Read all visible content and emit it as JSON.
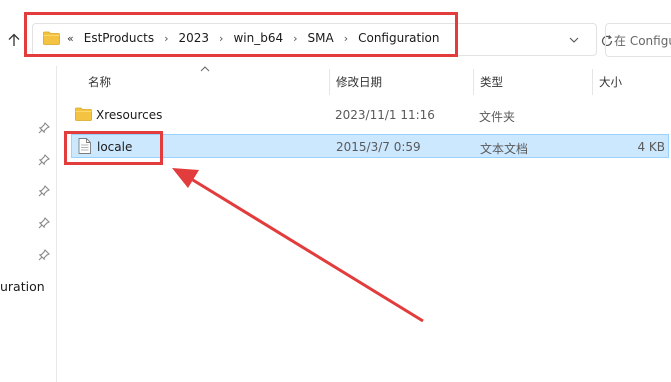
{
  "address": {
    "overflow_marker": "«",
    "path": [
      "EstProducts",
      "2023",
      "win_b64",
      "SMA",
      "Configuration"
    ]
  },
  "search": {
    "placeholder": "在 Configu"
  },
  "nav": {
    "partial_label": "uration"
  },
  "columns": {
    "name": "名称",
    "modified": "修改日期",
    "type": "类型",
    "size": "大小"
  },
  "files": [
    {
      "name": "Xresources",
      "modified": "2023/11/1 11:16",
      "type": "文件夹",
      "size": "",
      "icon": "folder-icon",
      "selected": false
    },
    {
      "name": "locale",
      "modified": "2015/3/7 0:59",
      "type": "文本文档",
      "size": "4 KB",
      "icon": "text-file-icon",
      "selected": true
    }
  ],
  "colors": {
    "highlight": "#e23c3c",
    "selection": "#cce8ff",
    "folder": "#f4c342"
  },
  "icons": {
    "up": "arrow-up-icon",
    "address_folder": "folder-icon",
    "dropdown": "chevron-down-icon",
    "refresh": "refresh-icon",
    "pin": "pin-icon",
    "sort": "sort-up-icon"
  }
}
